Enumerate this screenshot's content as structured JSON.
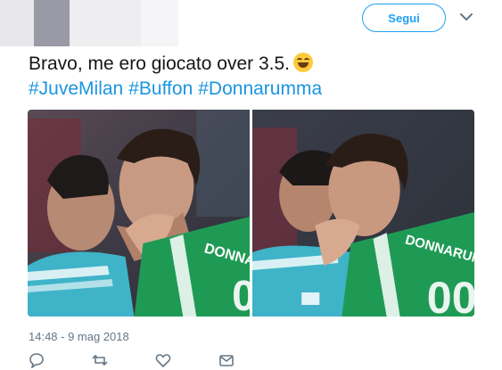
{
  "header": {
    "follow_label": "Segui",
    "caret_icon": "chevron-down-icon"
  },
  "tweet": {
    "text": "Bravo, me ero giocato over 3.5.",
    "emoji": "rolling-on-floor-laughing",
    "hashtags": [
      "#JuveMilan",
      "#Buffon",
      "#Donnarumma"
    ],
    "timestamp": "14:48 - 9 mag 2018"
  },
  "photos": [
    {
      "jersey_text": "DONNARUMMA"
    },
    {
      "jersey_text": "DONNARUMMA"
    }
  ],
  "actions": [
    "reply-icon",
    "retweet-icon",
    "like-icon",
    "message-icon"
  ],
  "colors": {
    "accent": "#1da1f2",
    "hashtag": "#1b95e0",
    "muted": "#657786",
    "jersey_green": "#1f9a55",
    "juve_cyan": "#3fb3c8"
  }
}
